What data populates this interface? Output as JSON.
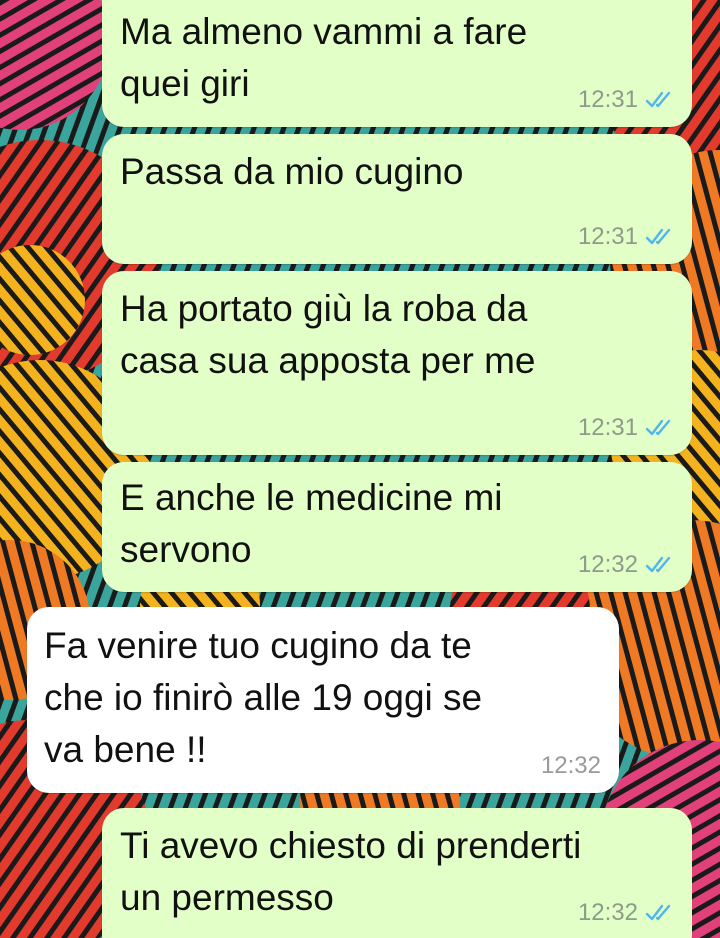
{
  "conversation": {
    "messages": [
      {
        "direction": "outgoing",
        "text": "Ma almeno vammi a fare\nquei giri",
        "time": "12:31",
        "status": "read-double-check-icon"
      },
      {
        "direction": "outgoing",
        "text": "Passa da mio cugino",
        "time": "12:31",
        "status": "read-double-check-icon"
      },
      {
        "direction": "outgoing",
        "text": "Ha portato giù la roba da\ncasa sua apposta per me",
        "time": "12:31",
        "status": "read-double-check-icon"
      },
      {
        "direction": "outgoing",
        "text": "E anche le medicine mi\nservono",
        "time": "12:32",
        "status": "read-double-check-icon"
      },
      {
        "direction": "incoming",
        "text": "Fa venire tuo cugino da te\nche io finirò alle 19 oggi se\nva bene !!",
        "time": "12:32"
      },
      {
        "direction": "outgoing",
        "text": "Ti avevo chiesto di prenderti\nun permesso",
        "time": "12:32",
        "status": "read-double-check-icon"
      }
    ]
  },
  "colors": {
    "outgoing_bubble": "#e2ffc8",
    "incoming_bubble": "#ffffff",
    "read_tick": "#4fb6ec",
    "time_text": "#8e9a8a"
  }
}
